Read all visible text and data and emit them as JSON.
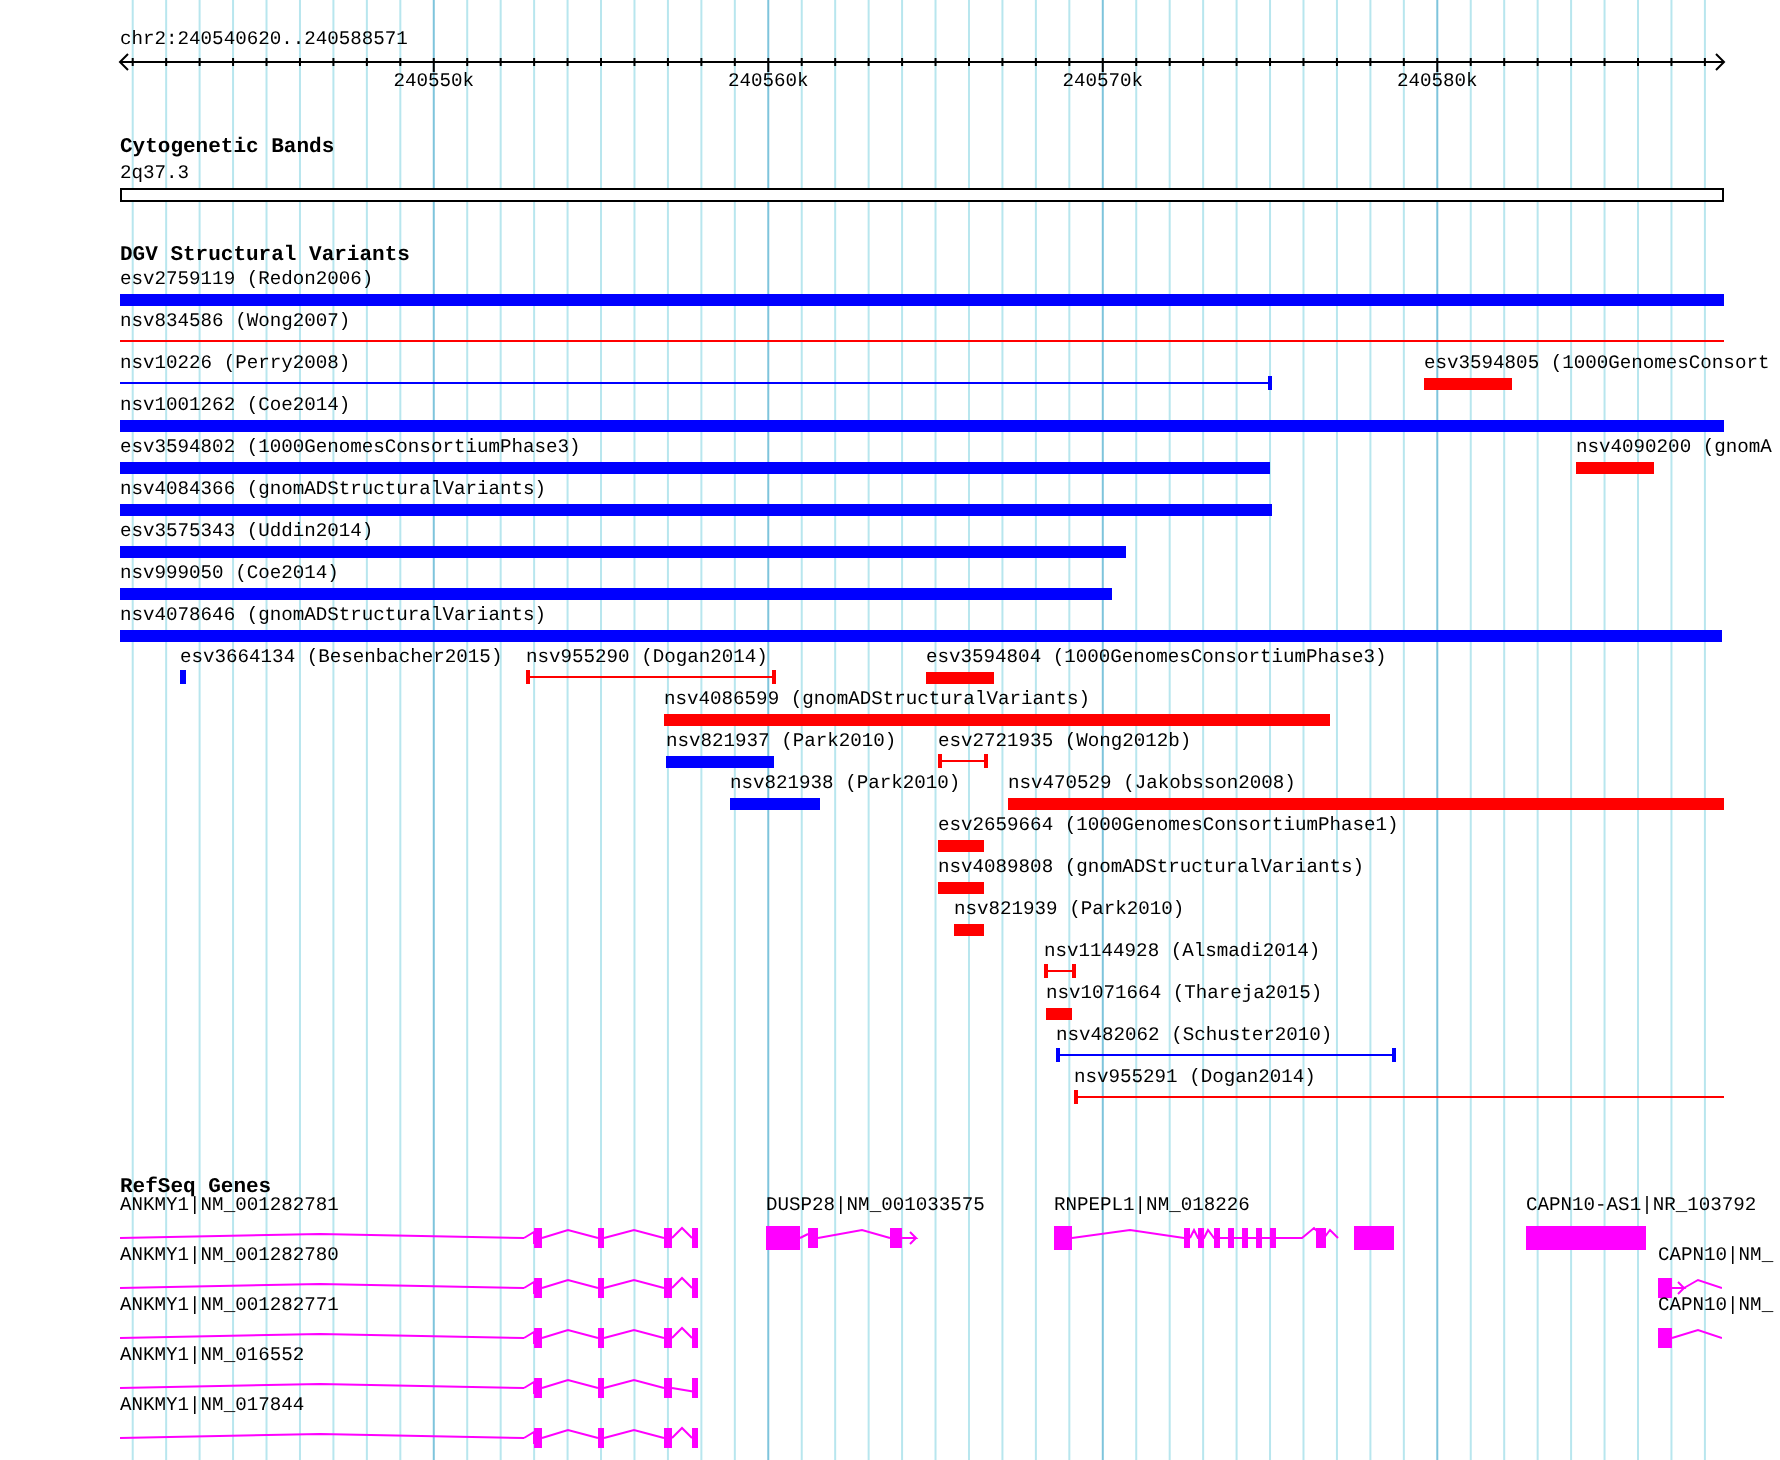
{
  "ruler": {
    "location": "chr2:240540620..240588571",
    "ticks": [
      "240550k",
      "240560k",
      "240570k",
      "240580k"
    ]
  },
  "cytogenetic_bands": {
    "title": "Cytogenetic Bands",
    "band": "2q37.3"
  },
  "dgv_structural_variants": {
    "title": "DGV Structural Variants",
    "features": [
      {
        "name": "esv2759119 (Redon2006)",
        "color": "#0000ff",
        "kind": "thick"
      },
      {
        "name": "nsv834586 (Wong2007)",
        "color": "#ff0000",
        "kind": "thin"
      },
      {
        "name": "nsv10226 (Perry2008)",
        "color": "#0000ff",
        "kind": "thin"
      },
      {
        "name": "esv3594805 (1000GenomesConsort",
        "color": "#ff0000",
        "kind": "thick"
      },
      {
        "name": "nsv1001262 (Coe2014)",
        "color": "#0000ff",
        "kind": "thick"
      },
      {
        "name": "esv3594802 (1000GenomesConsortiumPhase3)",
        "color": "#0000ff",
        "kind": "thick"
      },
      {
        "name": "nsv4090200 (gnomA",
        "color": "#ff0000",
        "kind": "thick"
      },
      {
        "name": "nsv4084366 (gnomADStructuralVariants)",
        "color": "#0000ff",
        "kind": "thick"
      },
      {
        "name": "esv3575343 (Uddin2014)",
        "color": "#0000ff",
        "kind": "thick"
      },
      {
        "name": "nsv999050 (Coe2014)",
        "color": "#0000ff",
        "kind": "thick"
      },
      {
        "name": "nsv4078646 (gnomADStructuralVariants)",
        "color": "#0000ff",
        "kind": "thick"
      },
      {
        "name": "esv3664134 (Besenbacher2015)",
        "color": "#0000ff",
        "kind": "thin"
      },
      {
        "name": "nsv955290 (Dogan2014)",
        "color": "#ff0000",
        "kind": "thin"
      },
      {
        "name": "esv3594804 (1000GenomesConsortiumPhase3)",
        "color": "#ff0000",
        "kind": "thick"
      },
      {
        "name": "nsv4086599 (gnomADStructuralVariants)",
        "color": "#ff0000",
        "kind": "thick"
      },
      {
        "name": "nsv821937 (Park2010)",
        "color": "#0000ff",
        "kind": "thick"
      },
      {
        "name": "esv2721935 (Wong2012b)",
        "color": "#ff0000",
        "kind": "thin"
      },
      {
        "name": "nsv821938 (Park2010)",
        "color": "#0000ff",
        "kind": "thick"
      },
      {
        "name": "nsv470529 (Jakobsson2008)",
        "color": "#ff0000",
        "kind": "thick"
      },
      {
        "name": "esv2659664 (1000GenomesConsortiumPhase1)",
        "color": "#ff0000",
        "kind": "thick"
      },
      {
        "name": "nsv4089808 (gnomADStructuralVariants)",
        "color": "#ff0000",
        "kind": "thick"
      },
      {
        "name": "nsv821939 (Park2010)",
        "color": "#ff0000",
        "kind": "thick"
      },
      {
        "name": "nsv1144928 (Alsmadi2014)",
        "color": "#ff0000",
        "kind": "thin"
      },
      {
        "name": "nsv1071664 (Thareja2015)",
        "color": "#ff0000",
        "kind": "thick"
      },
      {
        "name": "nsv482062 (Schuster2010)",
        "color": "#0000ff",
        "kind": "thin"
      },
      {
        "name": "nsv955291 (Dogan2014)",
        "color": "#ff0000",
        "kind": "thin"
      }
    ]
  },
  "refseq_genes": {
    "title": "RefSeq Genes",
    "genes": [
      {
        "label": "ANKMY1|NM_001282781"
      },
      {
        "label": "DUSP28|NM_001033575"
      },
      {
        "label": "RNPEPL1|NM_018226"
      },
      {
        "label": "CAPN10-AS1|NR_103792"
      },
      {
        "label": "ANKMY1|NM_001282780"
      },
      {
        "label": "CAPN10|NM_"
      },
      {
        "label": "ANKMY1|NM_001282771"
      },
      {
        "label": "CAPN10|NM_"
      },
      {
        "label": "ANKMY1|NM_016552"
      },
      {
        "label": "ANKMY1|NM_017844"
      }
    ]
  }
}
